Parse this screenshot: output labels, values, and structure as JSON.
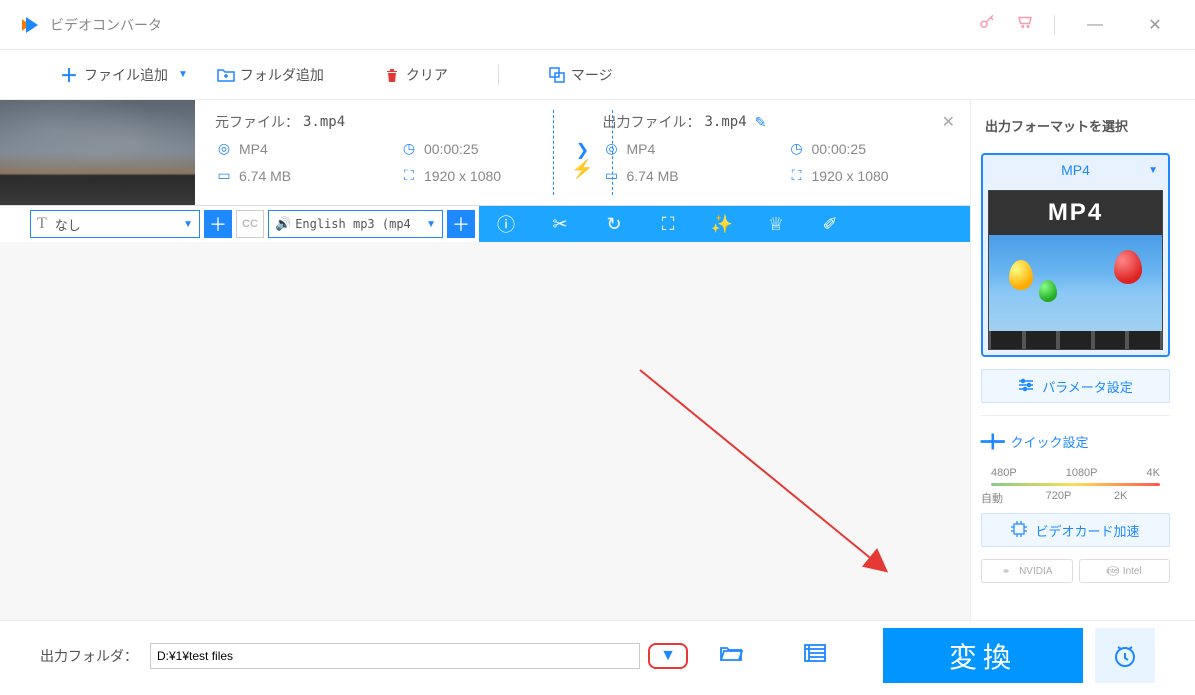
{
  "app": {
    "title": "ビデオコンバータ"
  },
  "toolbar": {
    "add_file": "ファイル追加",
    "add_folder": "フォルダ追加",
    "clear": "クリア",
    "merge": "マージ"
  },
  "file": {
    "source_label": "元ファイル：",
    "source_name": "3.mp4",
    "output_label": "出力ファイル：",
    "output_name": "3.mp4",
    "src_format": "MP4",
    "src_duration": "00:00:25",
    "src_size": "6.74 MB",
    "src_res": "1920 x 1080",
    "out_format": "MP4",
    "out_duration": "00:00:25",
    "out_size": "6.74 MB",
    "out_res": "1920 x 1080"
  },
  "subtitle": {
    "value": "なし"
  },
  "audio": {
    "value": "English mp3 (mp4"
  },
  "sidebar": {
    "title": "出力フォーマットを選択",
    "format": "MP4",
    "param_btn": "パラメータ設定",
    "quick_title": "クイック設定",
    "res": {
      "p480": "480P",
      "p1080": "1080P",
      "p4k": "4K",
      "auto": "自動",
      "p720": "720P",
      "p2k": "2K"
    },
    "hw_btn": "ビデオカード加速",
    "nvidia": "NVIDIA",
    "intel": "Intel"
  },
  "bottom": {
    "label": "出力フォルダ：",
    "path": "D:¥1¥test files",
    "convert": "変換"
  }
}
